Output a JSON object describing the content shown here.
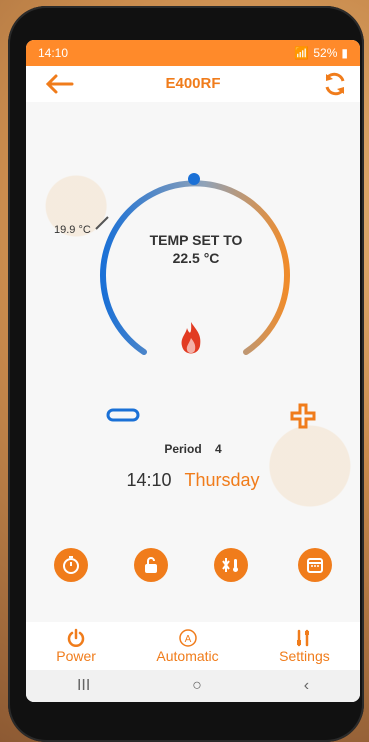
{
  "status": {
    "time": "14:10",
    "battery": "52%"
  },
  "header": {
    "title": "E400RF"
  },
  "thermostat": {
    "current_temp": "19.9 °C",
    "set_caption": "TEMP SET TO",
    "set_value": "22.5 °C",
    "period_label": "Period",
    "period_value": "4",
    "time": "14:10",
    "day": "Thursday"
  },
  "nav": {
    "power": "Power",
    "automatic": "Automatic",
    "settings": "Settings"
  },
  "system": {
    "recent": "III",
    "home": "○",
    "back": "‹"
  },
  "colors": {
    "accent": "#f07c1b",
    "cold": "#2b7bd1",
    "flame": "#e23b22"
  }
}
